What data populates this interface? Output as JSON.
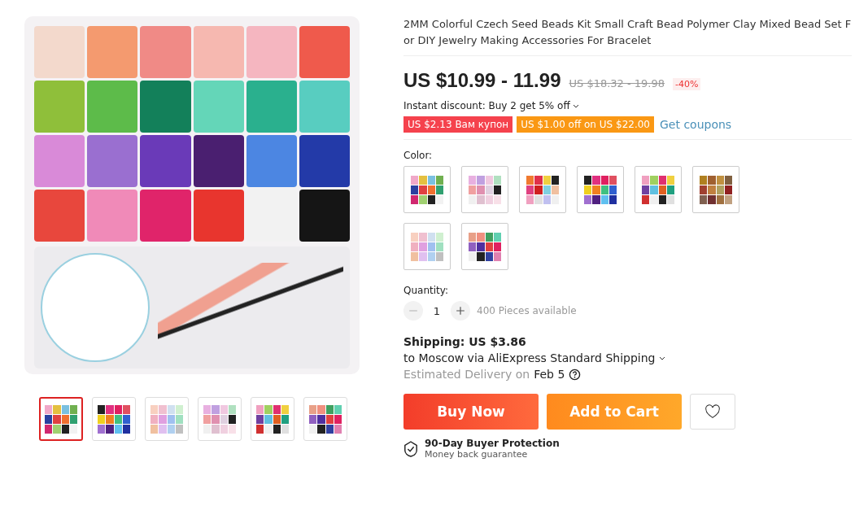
{
  "gallery": {
    "thumbnails": [
      {
        "selected": true
      },
      {
        "selected": false
      },
      {
        "selected": false
      },
      {
        "selected": false
      },
      {
        "selected": false
      },
      {
        "selected": false
      }
    ]
  },
  "product": {
    "title": "2MM Colorful Czech Seed Beads Kit Small Craft Bead Polymer Clay Mixed Bead Set For DIY Jewelry Making Accessories For Bracelet",
    "price": "US $10.99 - 11.99",
    "old_price": "US $18.32 - 19.98",
    "discount": "-40%",
    "instant_discount": "Instant discount: Buy 2 get 5% off",
    "coupons": [
      {
        "label": "US $2.13 Вам купон",
        "color": "#f5424d"
      },
      {
        "label": "US $1.00 off on US $22.00",
        "color": "#fa9814"
      }
    ],
    "get_coupons": "Get coupons",
    "color_label": "Color:",
    "colors": [
      {
        "selected": false
      },
      {
        "selected": false
      },
      {
        "selected": false
      },
      {
        "selected": false
      },
      {
        "selected": false
      },
      {
        "selected": false
      },
      {
        "selected": false
      },
      {
        "selected": false
      }
    ],
    "quantity_label": "Quantity:",
    "quantity": "1",
    "available": "400 Pieces available",
    "shipping": "Shipping: US $3.86",
    "shipping_route": "to Moscow via AliExpress Standard Shipping",
    "delivery_label": "Estimated Delivery on",
    "delivery_date": "Feb 5",
    "buy_now": "Buy Now",
    "add_to_cart": "Add to Cart",
    "protection_title": "90-Day Buyer Protection",
    "protection_sub": "Money back guarantee"
  }
}
